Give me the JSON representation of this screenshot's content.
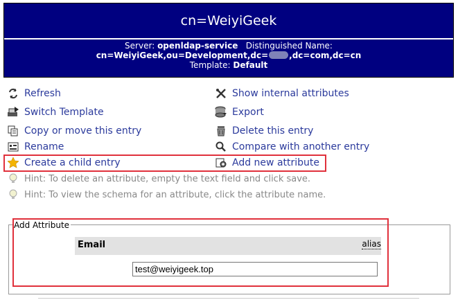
{
  "header": {
    "title": "cn=WeiyiGeek",
    "server_label": "Server:",
    "server_value": "openldap-service",
    "dn_label": "Distinguished Name:",
    "dn_prefix": "cn=WeiyiGeek,ou=Development,dc=",
    "dn_suffix": ",dc=com,dc=cn",
    "template_label": "Template:",
    "template_value": "Default"
  },
  "actions": {
    "refresh": "Refresh",
    "switch_template": "Switch Template",
    "copy_move": "Copy or move this entry",
    "rename": "Rename",
    "create_child": "Create a child entry",
    "show_internal": "Show internal attributes",
    "export": "Export",
    "delete": "Delete this entry",
    "compare": "Compare with another entry",
    "add_attribute": "Add new attribute"
  },
  "hints": [
    "Hint: To delete an attribute, empty the text field and click save.",
    "Hint: To view the schema for an attribute, click the attribute name."
  ],
  "add_attribute": {
    "legend": "Add Attribute",
    "attr_name": "Email",
    "alias_label": "alias",
    "value": "test@weiyigeek.top"
  },
  "colors": {
    "banner": "#000080",
    "link": "#2b3a9c",
    "highlight": "#e0303b"
  }
}
